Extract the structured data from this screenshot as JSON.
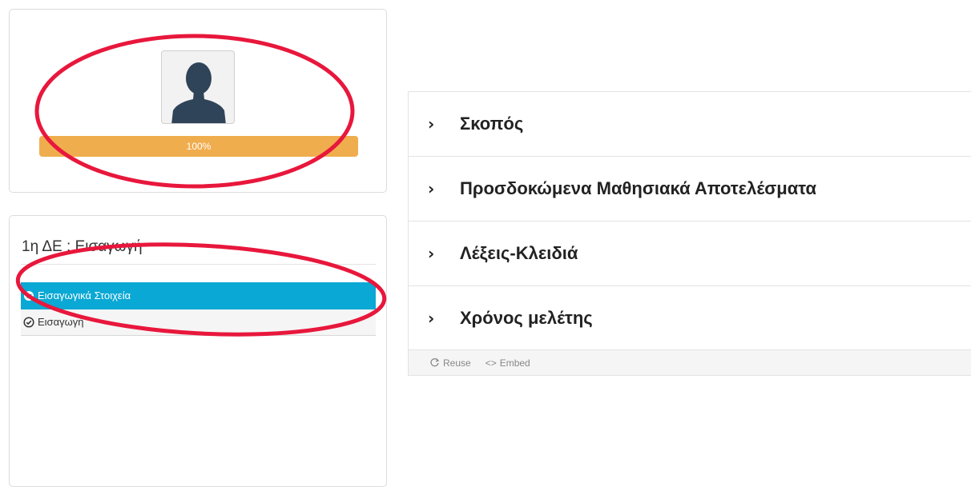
{
  "profile": {
    "progress_percent": 100,
    "progress_label": "100%",
    "progress_color": "#f0ad4e",
    "avatar_icon": "user-silhouette-icon"
  },
  "unit": {
    "title": "1η ΔΕ : Εισαγωγή",
    "lessons": [
      {
        "label": "Εισαγωγικά Στοιχεία",
        "active": true,
        "icon": "check-circle-icon"
      },
      {
        "label": "Εισαγωγή",
        "active": false,
        "icon": "check-circle-icon"
      }
    ],
    "active_color": "#0aa8d4"
  },
  "accordion": {
    "items": [
      {
        "label": "Σκοπός"
      },
      {
        "label": "Προσδοκώμενα Μαθησιακά Αποτελέσματα"
      },
      {
        "label": "Λέξεις-Κλειδιά"
      },
      {
        "label": "Χρόνος μελέτης"
      }
    ],
    "footer": {
      "reuse_label": "Reuse",
      "embed_label": "Embed",
      "embed_symbol": "<>"
    }
  },
  "annotation_color": "#e8173c"
}
